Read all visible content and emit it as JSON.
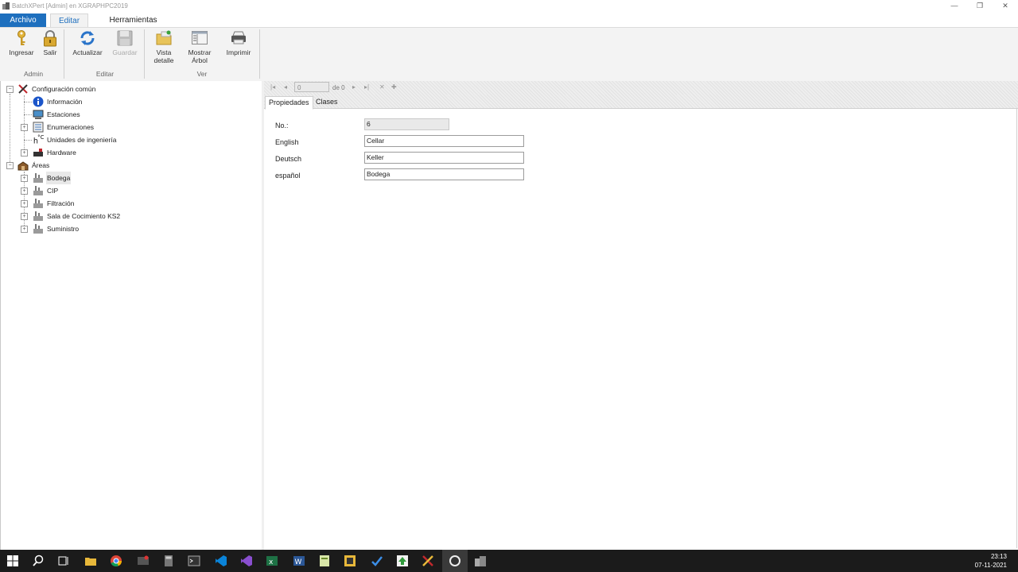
{
  "window": {
    "title": "BatchXPert [Admin] en XGRAPHPC2019"
  },
  "menu": {
    "archivo": "Archivo",
    "editar": "Editar",
    "herramientas": "Herramientas"
  },
  "ribbon": {
    "ingresar": "Ingresar",
    "salir": "Salir",
    "actualizar": "Actualizar",
    "guardar": "Guardar",
    "vista_detalle_1": "Vista",
    "vista_detalle_2": "detalle",
    "mostrar_arbol_1": "Mostrar",
    "mostrar_arbol_2": "Árbol",
    "imprimir": "Imprimir",
    "group_admin": "Admin",
    "group_editar": "Editar",
    "group_ver": "Ver"
  },
  "tree": {
    "config": "Configuración común",
    "informacion": "Información",
    "estaciones": "Estaciones",
    "enumeraciones": "Enumeraciones",
    "unidades": "Unidades de ingeniería",
    "hardware": "Hardware",
    "areas": "Áreas",
    "bodega": "Bodega",
    "cip": "CIP",
    "filtracion": "Filtración",
    "sala": "Sala de Cocimiento KS2",
    "suministro": "Suministro"
  },
  "nav": {
    "record_value": "0",
    "of_text": "de 0"
  },
  "tabs": {
    "propiedades": "Propiedades",
    "clases": "Clases"
  },
  "form": {
    "no_label": "No.:",
    "no_value": "6",
    "english_label": "English",
    "english_value": "Cellar",
    "deutsch_label": "Deutsch",
    "deutsch_value": "Keller",
    "espanol_label": "español",
    "espanol_value": "Bodega"
  },
  "clock": {
    "time": "23:13",
    "date": "07-11-2021"
  },
  "icons": {
    "ingresar": "key-icon",
    "salir": "lock-icon",
    "actualizar": "refresh-icon",
    "guardar": "save-icon",
    "vista": "folder-detail-icon",
    "arbol": "window-tree-icon",
    "imprimir": "printer-icon"
  },
  "colors": {
    "accent": "#1e6fbe"
  }
}
